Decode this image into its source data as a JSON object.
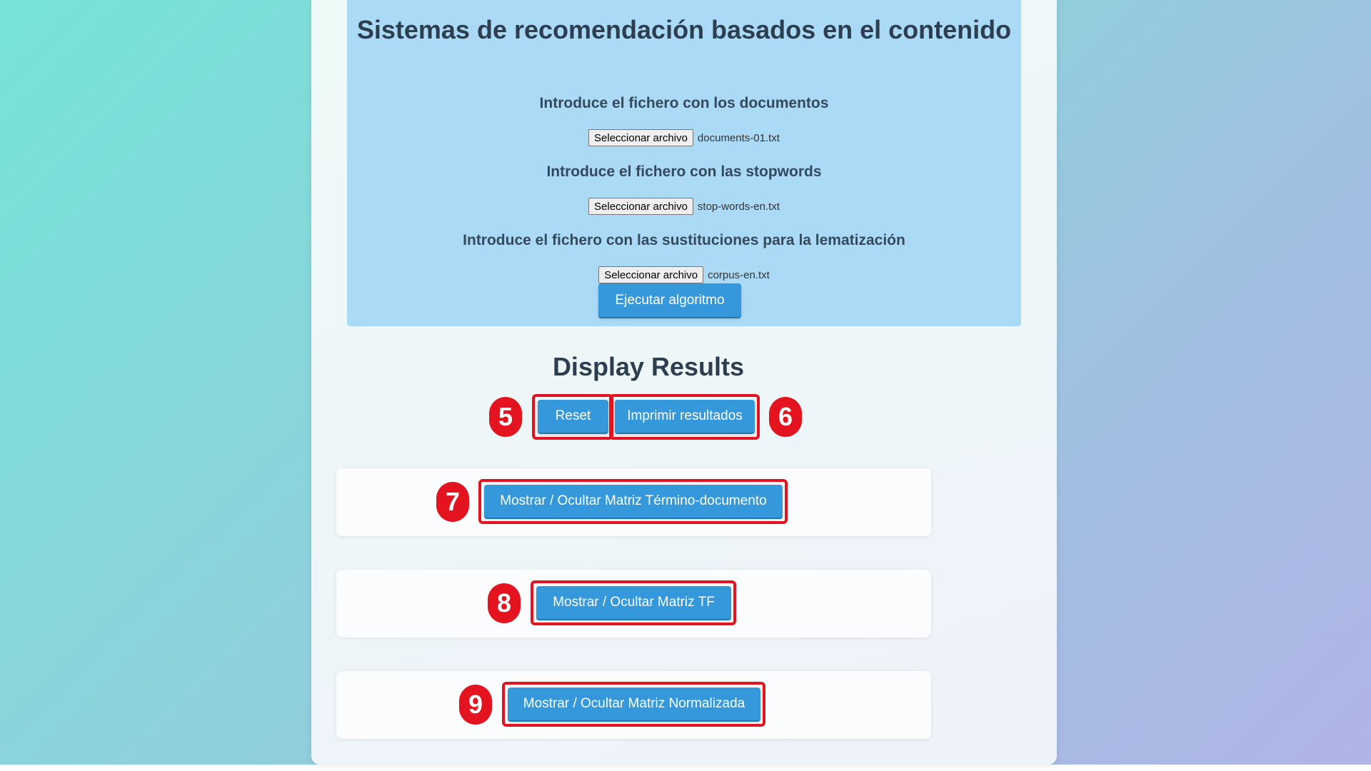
{
  "form": {
    "title": "Sistemas de recomendación basados en el contenido",
    "documents_label": "Introduce el fichero con los documentos",
    "documents_button": "Seleccionar archivo",
    "documents_file": "documents-01.txt",
    "stopwords_label": "Introduce el fichero con las stopwords",
    "stopwords_button": "Seleccionar archivo",
    "stopwords_file": "stop-words-en.txt",
    "lemmatization_label": "Introduce el fichero con las sustituciones para la lematización",
    "lemmatization_button": "Seleccionar archivo",
    "lemmatization_file": "corpus-en.txt",
    "run_button": "Ejecutar algoritmo"
  },
  "results": {
    "title": "Display Results",
    "reset_button": "Reset",
    "print_button": "Imprimir resultados",
    "toggle_term_document": "Mostrar / Ocultar Matriz Término-documento",
    "toggle_tf": "Mostrar / Ocultar Matriz TF",
    "toggle_normalized": "Mostrar / Ocultar Matriz Normalizada"
  },
  "annotations": {
    "badge_5": "5",
    "badge_6": "6",
    "badge_7": "7",
    "badge_8": "8",
    "badge_9": "9",
    "highlight_color": "#e3141f"
  },
  "colors": {
    "primary_button": "#3498db",
    "form_panel": "#abdaf6",
    "heading": "#2c3e50"
  }
}
